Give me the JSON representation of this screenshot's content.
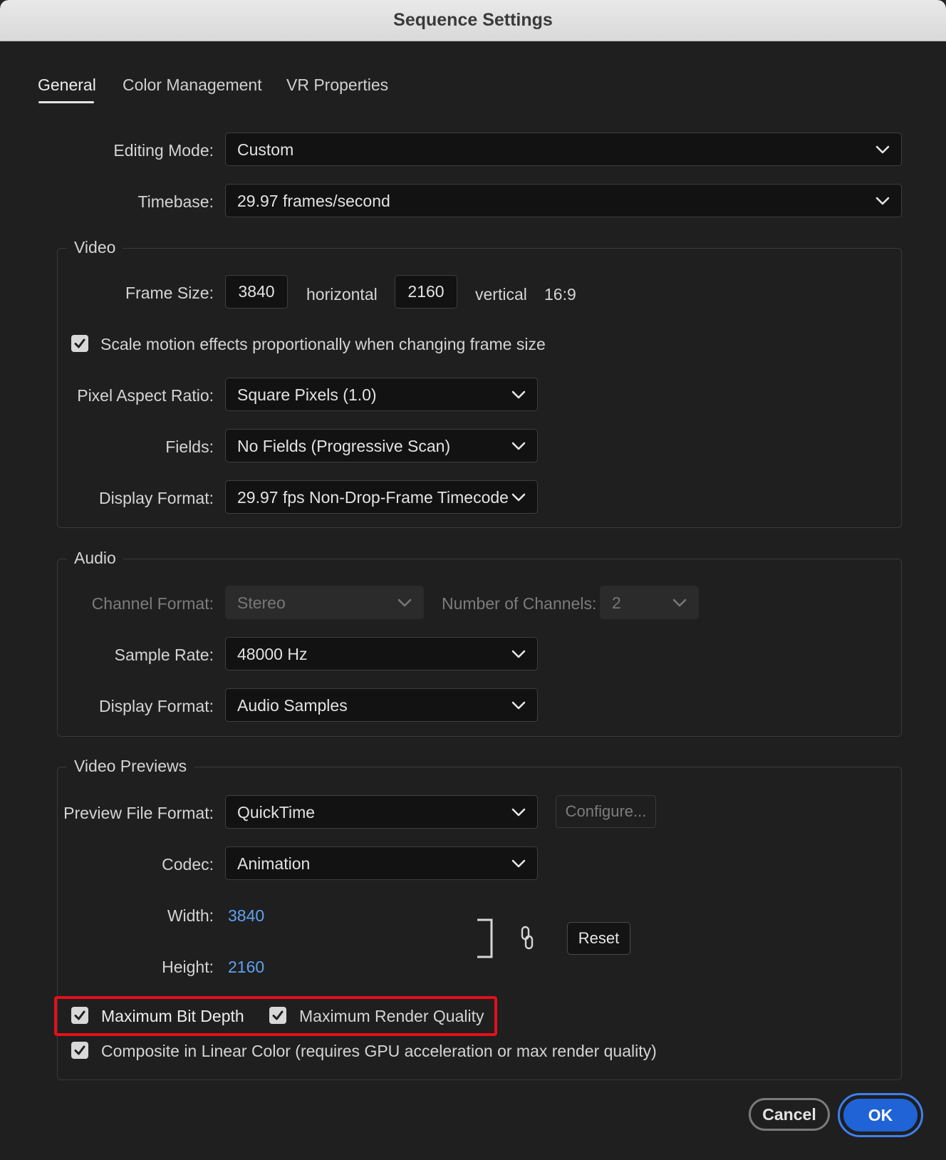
{
  "window": {
    "title": "Sequence Settings"
  },
  "tabs": [
    {
      "label": "General",
      "active": true
    },
    {
      "label": "Color Management",
      "active": false
    },
    {
      "label": "VR Properties",
      "active": false
    }
  ],
  "general": {
    "editing_mode": {
      "label": "Editing Mode:",
      "value": "Custom"
    },
    "timebase": {
      "label": "Timebase:",
      "value": "29.97  frames/second"
    }
  },
  "video": {
    "title": "Video",
    "frame_size_label": "Frame Size:",
    "width": "3840",
    "horizontal_label": "horizontal",
    "height": "2160",
    "vertical_label": "vertical",
    "aspect": "16:9",
    "scale_motion": {
      "label": "Scale motion effects proportionally when changing frame size",
      "checked": true
    },
    "pixel_aspect": {
      "label": "Pixel Aspect Ratio:",
      "value": "Square Pixels (1.0)"
    },
    "fields": {
      "label": "Fields:",
      "value": "No Fields (Progressive Scan)"
    },
    "display_format": {
      "label": "Display Format:",
      "value": "29.97 fps Non-Drop-Frame Timecode"
    }
  },
  "audio": {
    "title": "Audio",
    "channel_format": {
      "label": "Channel Format:",
      "value": "Stereo"
    },
    "num_channels": {
      "label": "Number of Channels:",
      "value": "2"
    },
    "sample_rate": {
      "label": "Sample Rate:",
      "value": "48000 Hz"
    },
    "display_format": {
      "label": "Display Format:",
      "value": "Audio Samples"
    }
  },
  "previews": {
    "title": "Video Previews",
    "file_format": {
      "label": "Preview File Format:",
      "value": "QuickTime"
    },
    "configure_label": "Configure...",
    "codec": {
      "label": "Codec:",
      "value": "Animation"
    },
    "width": {
      "label": "Width:",
      "value": "3840"
    },
    "height": {
      "label": "Height:",
      "value": "2160"
    },
    "reset_label": "Reset",
    "max_bit_depth": {
      "label": "Maximum Bit Depth",
      "checked": true
    },
    "max_render_quality": {
      "label": "Maximum Render Quality",
      "checked": true
    },
    "composite_linear": {
      "label": "Composite in Linear Color (requires GPU acceleration or max render quality)",
      "checked": true
    }
  },
  "footer": {
    "cancel_label": "Cancel",
    "ok_label": "OK"
  },
  "colors": {
    "accent": "#1f63d6",
    "highlight": "#e3101a",
    "link": "#5ea2ef"
  },
  "icons": {
    "chevron": "chevron-down-icon",
    "check": "checkmark-icon",
    "link": "chain-link-icon"
  }
}
